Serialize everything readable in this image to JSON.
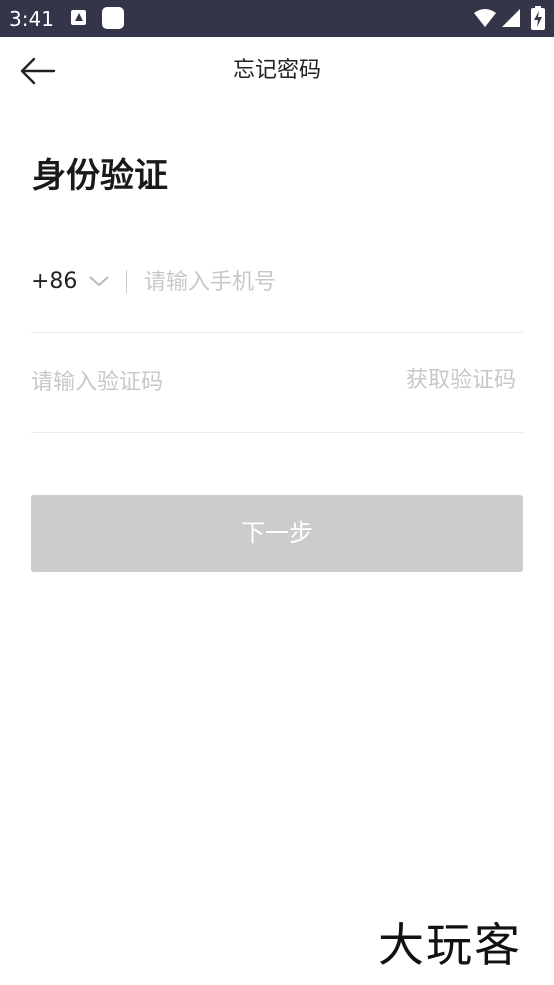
{
  "status_bar": {
    "time": "3:41",
    "icons": [
      "app-a-icon",
      "app-square-icon",
      "wifi-icon",
      "signal-icon",
      "battery-icon"
    ]
  },
  "header": {
    "back_icon": "arrow-left-icon",
    "title": "忘记密码"
  },
  "main": {
    "heading": "身份验证",
    "phone": {
      "country_code": "+86",
      "dropdown_icon": "chevron-down-icon",
      "placeholder": "请输入手机号",
      "value": ""
    },
    "code": {
      "placeholder": "请输入验证码",
      "value": "",
      "get_code_label": "获取验证码"
    },
    "next_button_label": "下一步"
  },
  "watermark": {
    "text": "大玩客"
  },
  "colors": {
    "status_bar_bg": "#35354a",
    "button_disabled_bg": "#cccccc",
    "placeholder_text": "#c8c8c8",
    "divider": "#ececec"
  }
}
